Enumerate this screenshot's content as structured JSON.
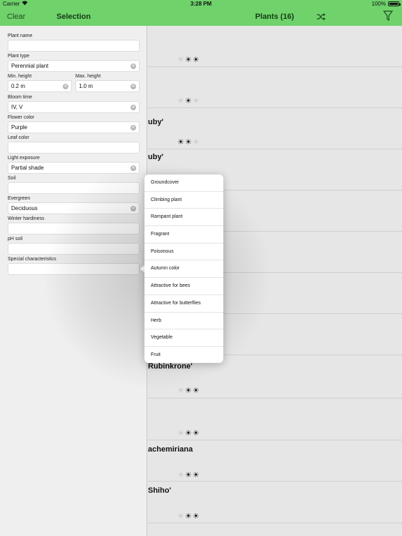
{
  "status": {
    "carrier": "Carrier",
    "time": "3:28 PM",
    "battery": "100%",
    "battery_level": 1.0
  },
  "left_bar": {
    "clear": "Clear",
    "title": "Selection"
  },
  "right_bar": {
    "title": "Plants (16)",
    "shuffle_icon": "shuffle-icon",
    "filter_icon": "filter-icon"
  },
  "form": {
    "plant_name": {
      "label": "Plant name",
      "value": ""
    },
    "plant_type": {
      "label": "Plant type",
      "value": "Perennial plant"
    },
    "min_height": {
      "label": "Min. height",
      "value": "0.2 m"
    },
    "max_height": {
      "label": "Max. height",
      "value": "1.0 m"
    },
    "bloom_time": {
      "label": "Bloom time",
      "value": "IV, V"
    },
    "flower_color": {
      "label": "Flower color",
      "value": "Purple"
    },
    "leaf_color": {
      "label": "Leaf color",
      "value": ""
    },
    "light_exposure": {
      "label": "Light exposure",
      "value": "Partial shade"
    },
    "soil": {
      "label": "Soil",
      "value": ""
    },
    "evergreen": {
      "label": "Evergreen",
      "value": "Deciduous"
    },
    "winter_hardiness": {
      "label": "Winter hardiness",
      "value": ""
    },
    "ph_soil": {
      "label": "pH soil",
      "value": ""
    },
    "special": {
      "label": "Special characteristics",
      "value": ""
    }
  },
  "list": {
    "rows": [
      {
        "name": "",
        "suns": "☀☀"
      },
      {
        "name": "",
        "suns": "☀"
      },
      {
        "name": "uby'",
        "suns": "☀☀"
      },
      {
        "name": "",
        "suns": ""
      },
      {
        "name": "",
        "suns": ""
      },
      {
        "name": "",
        "suns": ""
      },
      {
        "name": "",
        "suns": ""
      },
      {
        "name": "Rubinkrone'",
        "suns": "☀☀"
      },
      {
        "name": "",
        "suns": "☀☀"
      },
      {
        "name": "achemiriana",
        "suns": "☀☀"
      },
      {
        "name": "Shiho'",
        "suns": "☀☀"
      }
    ]
  },
  "popover": {
    "options": [
      "Groundcover",
      "Climbing plant",
      "Rampant plant",
      "Fragrant",
      "Poisonous",
      "Autumn color",
      "Attractive for bees",
      "Attractive for butterflies",
      "Herb",
      "Vegetable",
      "Fruit"
    ]
  },
  "colors": {
    "accent": "#6fd26b"
  }
}
